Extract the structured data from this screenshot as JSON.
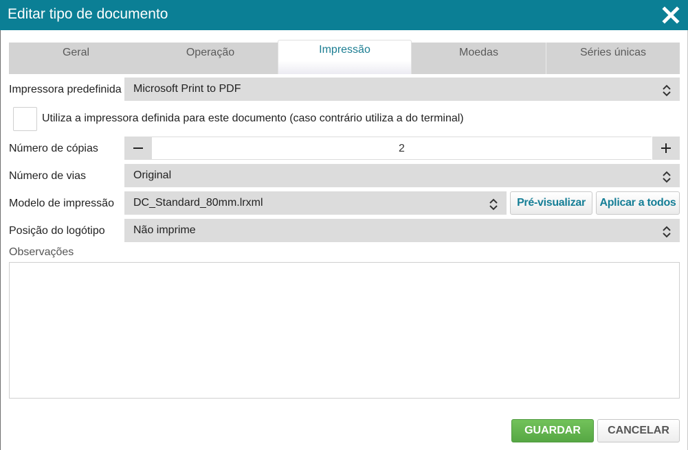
{
  "dialog": {
    "title": "Editar tipo de documento",
    "close_icon": "close-icon"
  },
  "tabs": [
    {
      "label": "Geral"
    },
    {
      "label": "Operação"
    },
    {
      "label": "Impressão",
      "active": true
    },
    {
      "label": "Moedas"
    },
    {
      "label": "Séries únicas"
    }
  ],
  "form": {
    "default_printer": {
      "label": "Impressora predefinida",
      "value": "Microsoft Print to PDF"
    },
    "use_printer_checkbox": {
      "label": "Utiliza a impressora definida para este documento (caso contrário utiliza a do terminal)",
      "checked": false
    },
    "copies": {
      "label": "Número de cópias",
      "value": "2"
    },
    "ways": {
      "label": "Número de vias",
      "value": "Original"
    },
    "print_model": {
      "label": "Modelo de impressão",
      "value": "DC_Standard_80mm.lrxml",
      "preview_label": "Pré-visualizar",
      "apply_all_label": "Aplicar a todos"
    },
    "logo_position": {
      "label": "Posição do logótipo",
      "value": "Não imprime"
    },
    "notes": {
      "label": "Observações",
      "value": ""
    }
  },
  "footer": {
    "save_label": "GUARDAR",
    "cancel_label": "CANCELAR"
  },
  "colors": {
    "titlebar": "#0b7f95",
    "accent_text": "#157e96",
    "save_button": "#60b04b"
  }
}
